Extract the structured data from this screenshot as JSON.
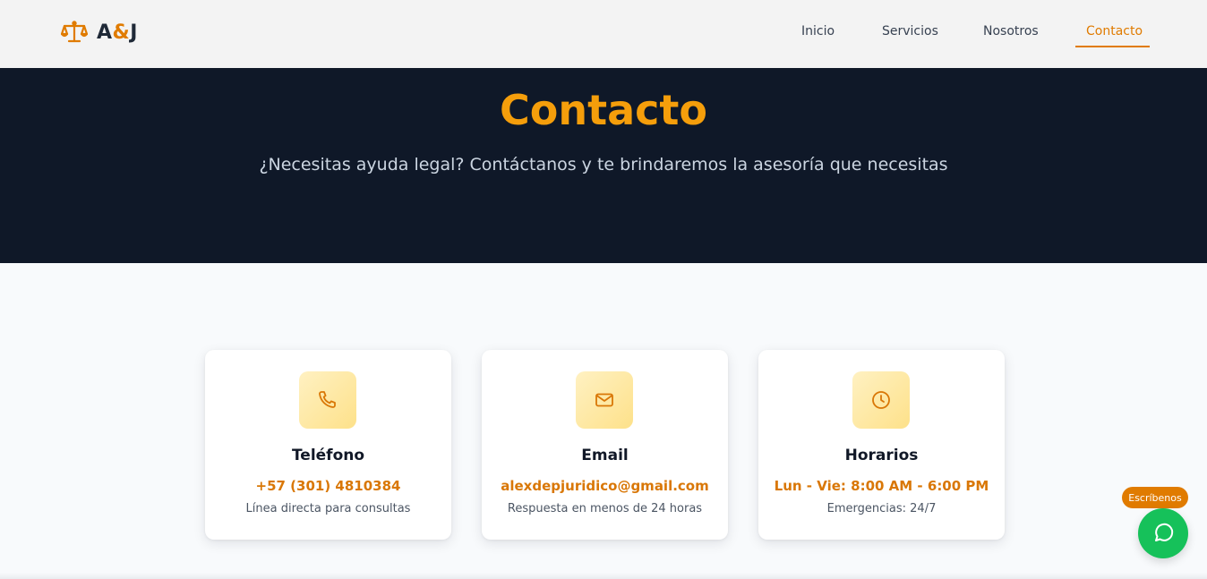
{
  "header": {
    "logo_text_a": "A",
    "logo_text_amp": "&",
    "logo_text_j": "J",
    "logo_icon": "scales-icon",
    "nav": [
      {
        "label": "Inicio",
        "active": false
      },
      {
        "label": "Servicios",
        "active": false
      },
      {
        "label": "Nosotros",
        "active": false
      },
      {
        "label": "Contacto",
        "active": true
      }
    ]
  },
  "hero": {
    "title": "Contacto",
    "subtitle": "¿Necesitas ayuda legal? Contáctanos y te brindaremos la asesoría que necesitas"
  },
  "cards": [
    {
      "icon": "phone-icon",
      "title": "Teléfono",
      "value": "+57 (301) 4810384",
      "desc": "Línea directa para consultas"
    },
    {
      "icon": "mail-icon",
      "title": "Email",
      "value": "alexdepjuridico@gmail.com",
      "desc": "Respuesta en menos de 24 horas"
    },
    {
      "icon": "clock-icon",
      "title": "Horarios",
      "value": "Lun - Vie: 8:00 AM - 6:00 PM",
      "desc": "Emergencias: 24/7"
    }
  ],
  "chat": {
    "badge": "Escríbenos",
    "icon": "whatsapp-icon"
  },
  "colors": {
    "accent": "#e07b00",
    "hero_bg": "#0f1828",
    "hero_title": "#f59e0b",
    "chat_green": "#16c15a"
  }
}
